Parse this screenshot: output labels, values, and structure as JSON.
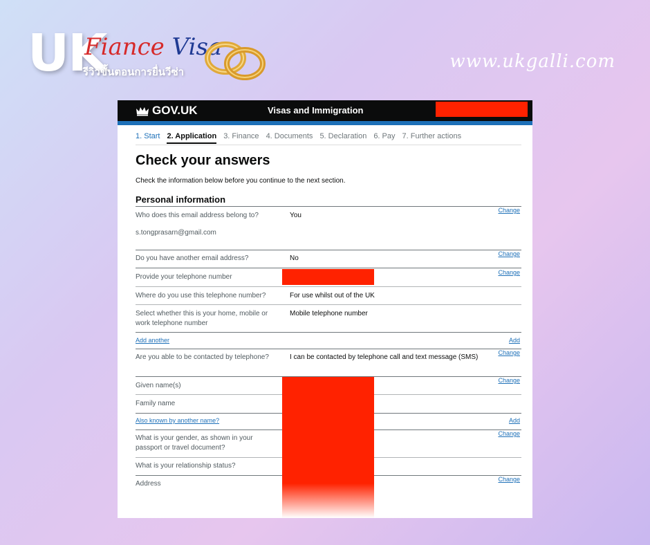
{
  "branding": {
    "uk": "UK",
    "fiance": "Fiance",
    "visa": "Visa",
    "thai_subtitle": "รีวิวขั้นตอนการยื่นวีซ่า",
    "website": "www.ukgalli.com"
  },
  "gov_header": {
    "logo_text": "GOV.UK",
    "service_name": "Visas and Immigration"
  },
  "steps": [
    {
      "label": "1. Start",
      "state": "done"
    },
    {
      "label": "2. Application",
      "state": "current"
    },
    {
      "label": "3. Finance",
      "state": "todo"
    },
    {
      "label": "4. Documents",
      "state": "todo"
    },
    {
      "label": "5. Declaration",
      "state": "todo"
    },
    {
      "label": "6. Pay",
      "state": "todo"
    },
    {
      "label": "7. Further actions",
      "state": "todo"
    }
  ],
  "page": {
    "title": "Check your answers",
    "intro": "Check the information below before you continue to the next section.",
    "section_title": "Personal information"
  },
  "rows": {
    "email_owner_q": "Who does this email address belong to?",
    "email_owner_a": "You",
    "email_address": "s.tongprasarn@gmail.com",
    "another_email_q": "Do you have another email address?",
    "another_email_a": "No",
    "telephone_q": "Provide your telephone number",
    "where_telephone_q": "Where do you use this telephone number?",
    "where_telephone_a": "For use whilst out of the UK",
    "phone_type_q": "Select whether this is your home, mobile or work telephone number",
    "phone_type_a": "Mobile telephone number",
    "add_another": "Add another",
    "contact_q": "Are you able to be contacted by telephone?",
    "contact_a": "I can be contacted by telephone call and text message (SMS)",
    "given_name_q": "Given name(s)",
    "family_name_q": "Family name",
    "aka_link": "Also known by another name?",
    "gender_q": "What is your gender, as shown in your passport or travel document?",
    "relationship_q": "What is your relationship status?",
    "address_q": "Address"
  },
  "actions": {
    "change": "Change",
    "add": "Add"
  },
  "colors": {
    "redaction": "#ff2200",
    "gov_black": "#0b0c0c",
    "gov_blue": "#1d70b8",
    "fiance_red": "#d62a2a",
    "visa_navy": "#1f3a93"
  }
}
